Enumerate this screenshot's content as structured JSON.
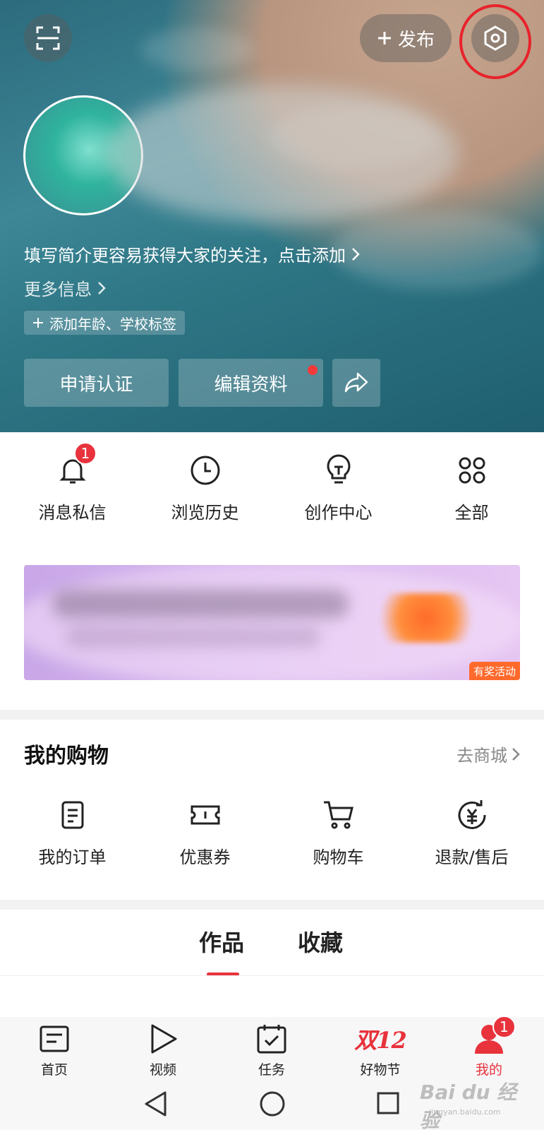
{
  "header": {
    "publish_label": "发布",
    "bio_prompt": "填写简介更容易获得大家的关注，点击添加",
    "more_info": "更多信息",
    "tag_chip": "添加年龄、学校标签",
    "buttons": {
      "verify": "申请认证",
      "edit_profile": "编辑资料"
    }
  },
  "quick": {
    "items": [
      {
        "label": "消息私信",
        "icon": "bell-icon",
        "badge": "1"
      },
      {
        "label": "浏览历史",
        "icon": "clock-icon"
      },
      {
        "label": "创作中心",
        "icon": "lightbulb-icon"
      },
      {
        "label": "全部",
        "icon": "grid-icon"
      }
    ]
  },
  "banner": {
    "tag": "有奖活动"
  },
  "shopping": {
    "title": "我的购物",
    "link": "去商城",
    "items": [
      {
        "label": "我的订单",
        "icon": "order-icon"
      },
      {
        "label": "优惠券",
        "icon": "coupon-icon"
      },
      {
        "label": "购物车",
        "icon": "cart-icon"
      },
      {
        "label": "退款/售后",
        "icon": "refund-icon"
      }
    ]
  },
  "tabs": [
    {
      "label": "作品",
      "active": true
    },
    {
      "label": "收藏",
      "active": false
    }
  ],
  "bottom_nav": {
    "items": [
      {
        "label": "首页",
        "icon": "home-icon"
      },
      {
        "label": "视频",
        "icon": "play-icon"
      },
      {
        "label": "任务",
        "icon": "calendar-check-icon"
      },
      {
        "label": "好物节",
        "icon": "double12-logo",
        "logo_text": "双12"
      },
      {
        "label": "我的",
        "icon": "user-icon",
        "active": true,
        "badge": "1"
      }
    ]
  },
  "watermark": {
    "brand": "Bai du 经验",
    "url": "jingyan.baidu.com"
  },
  "colors": {
    "accent_red": "#e8323c",
    "header_teal": "#2f7786",
    "highlight_circle": "#e8232b"
  }
}
